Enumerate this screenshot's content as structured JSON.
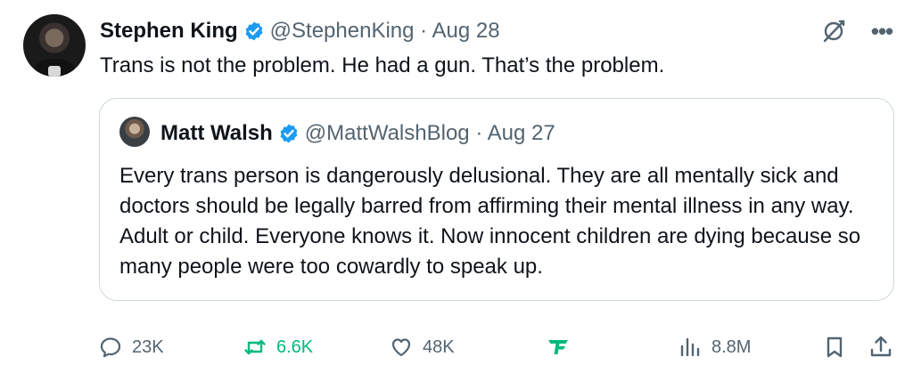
{
  "tweet": {
    "author_name": "Stephen King",
    "handle_date": "@StephenKing · Aug 28",
    "text": "Trans is not the problem. He had a gun. That’s the problem.",
    "icons": [
      "grok-icon",
      "more-icon"
    ]
  },
  "quoted": {
    "author_name": "Matt Walsh",
    "handle_date": "@MattWalshBlog · Aug 27",
    "text": "Every trans person is dangerously delusional. They are all mentally sick and doctors should be legally barred from affirming their mental illness in any way. Adult or child. Everyone knows it. Now innocent children are dying because so many people were too cowardly to speak up."
  },
  "actions": {
    "replies": "23K",
    "reposts": "6.6K",
    "likes": "48K",
    "views": "8.8M"
  },
  "colors": {
    "verified": "#1d9bf0",
    "repost_active": "#00ba7c",
    "muted_text": "#536471",
    "border": "#cfd9de"
  }
}
